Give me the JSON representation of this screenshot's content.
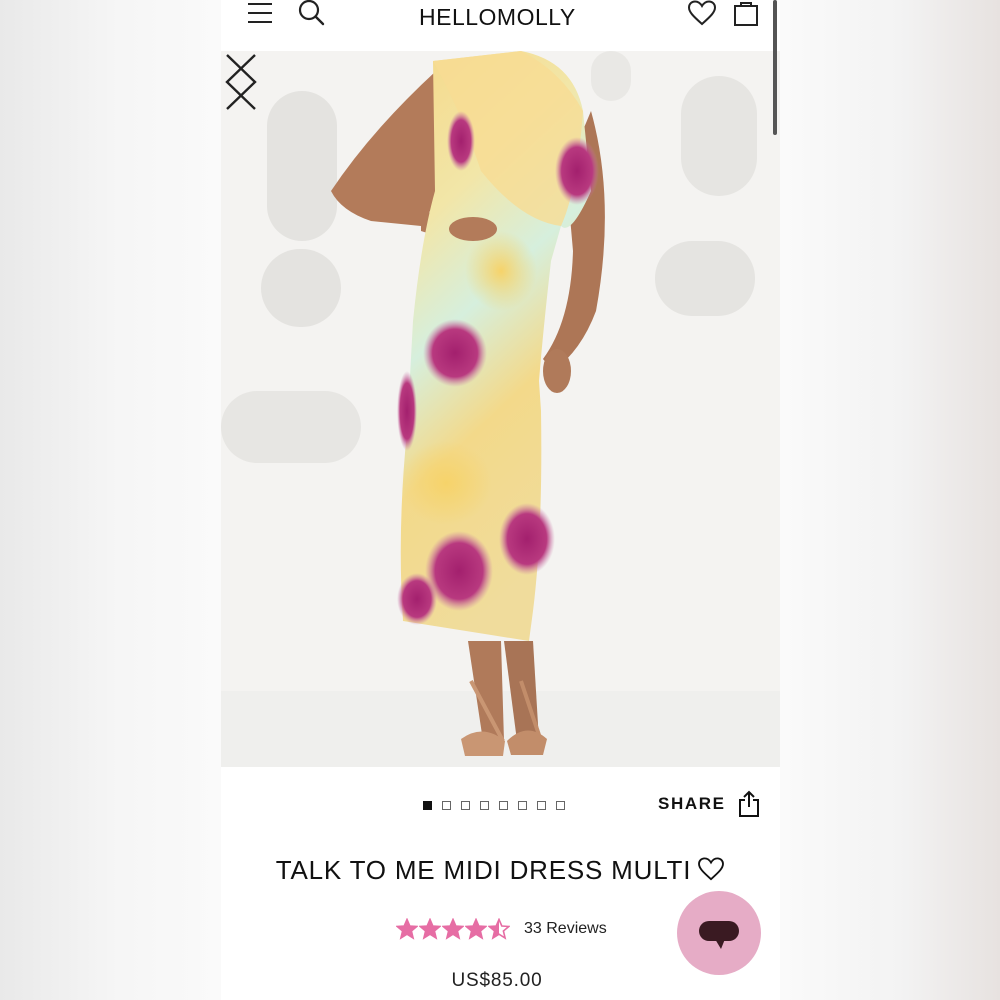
{
  "header": {
    "logo": "HELLOMOLLY",
    "icons": [
      "menu-icon",
      "search-icon",
      "heart-icon",
      "shopping-bag-icon"
    ]
  },
  "gallery": {
    "image_count": 8,
    "active_index": 0,
    "prev_icon": "chevron-left-icon",
    "next_icon": "chevron-right-icon"
  },
  "share": {
    "label": "SHARE",
    "icon": "share-icon"
  },
  "product": {
    "title": "TALK TO ME MIDI DRESS MULTI",
    "rating": 4.5,
    "rating_max": 5,
    "reviews_label": "33 Reviews",
    "price": "US$85.00"
  },
  "chat": {
    "icon": "chat-bubble-icon"
  },
  "colors": {
    "star": "#e66da4",
    "chat_bg": "#e6acc6",
    "chat_icon": "#3a1a22"
  }
}
